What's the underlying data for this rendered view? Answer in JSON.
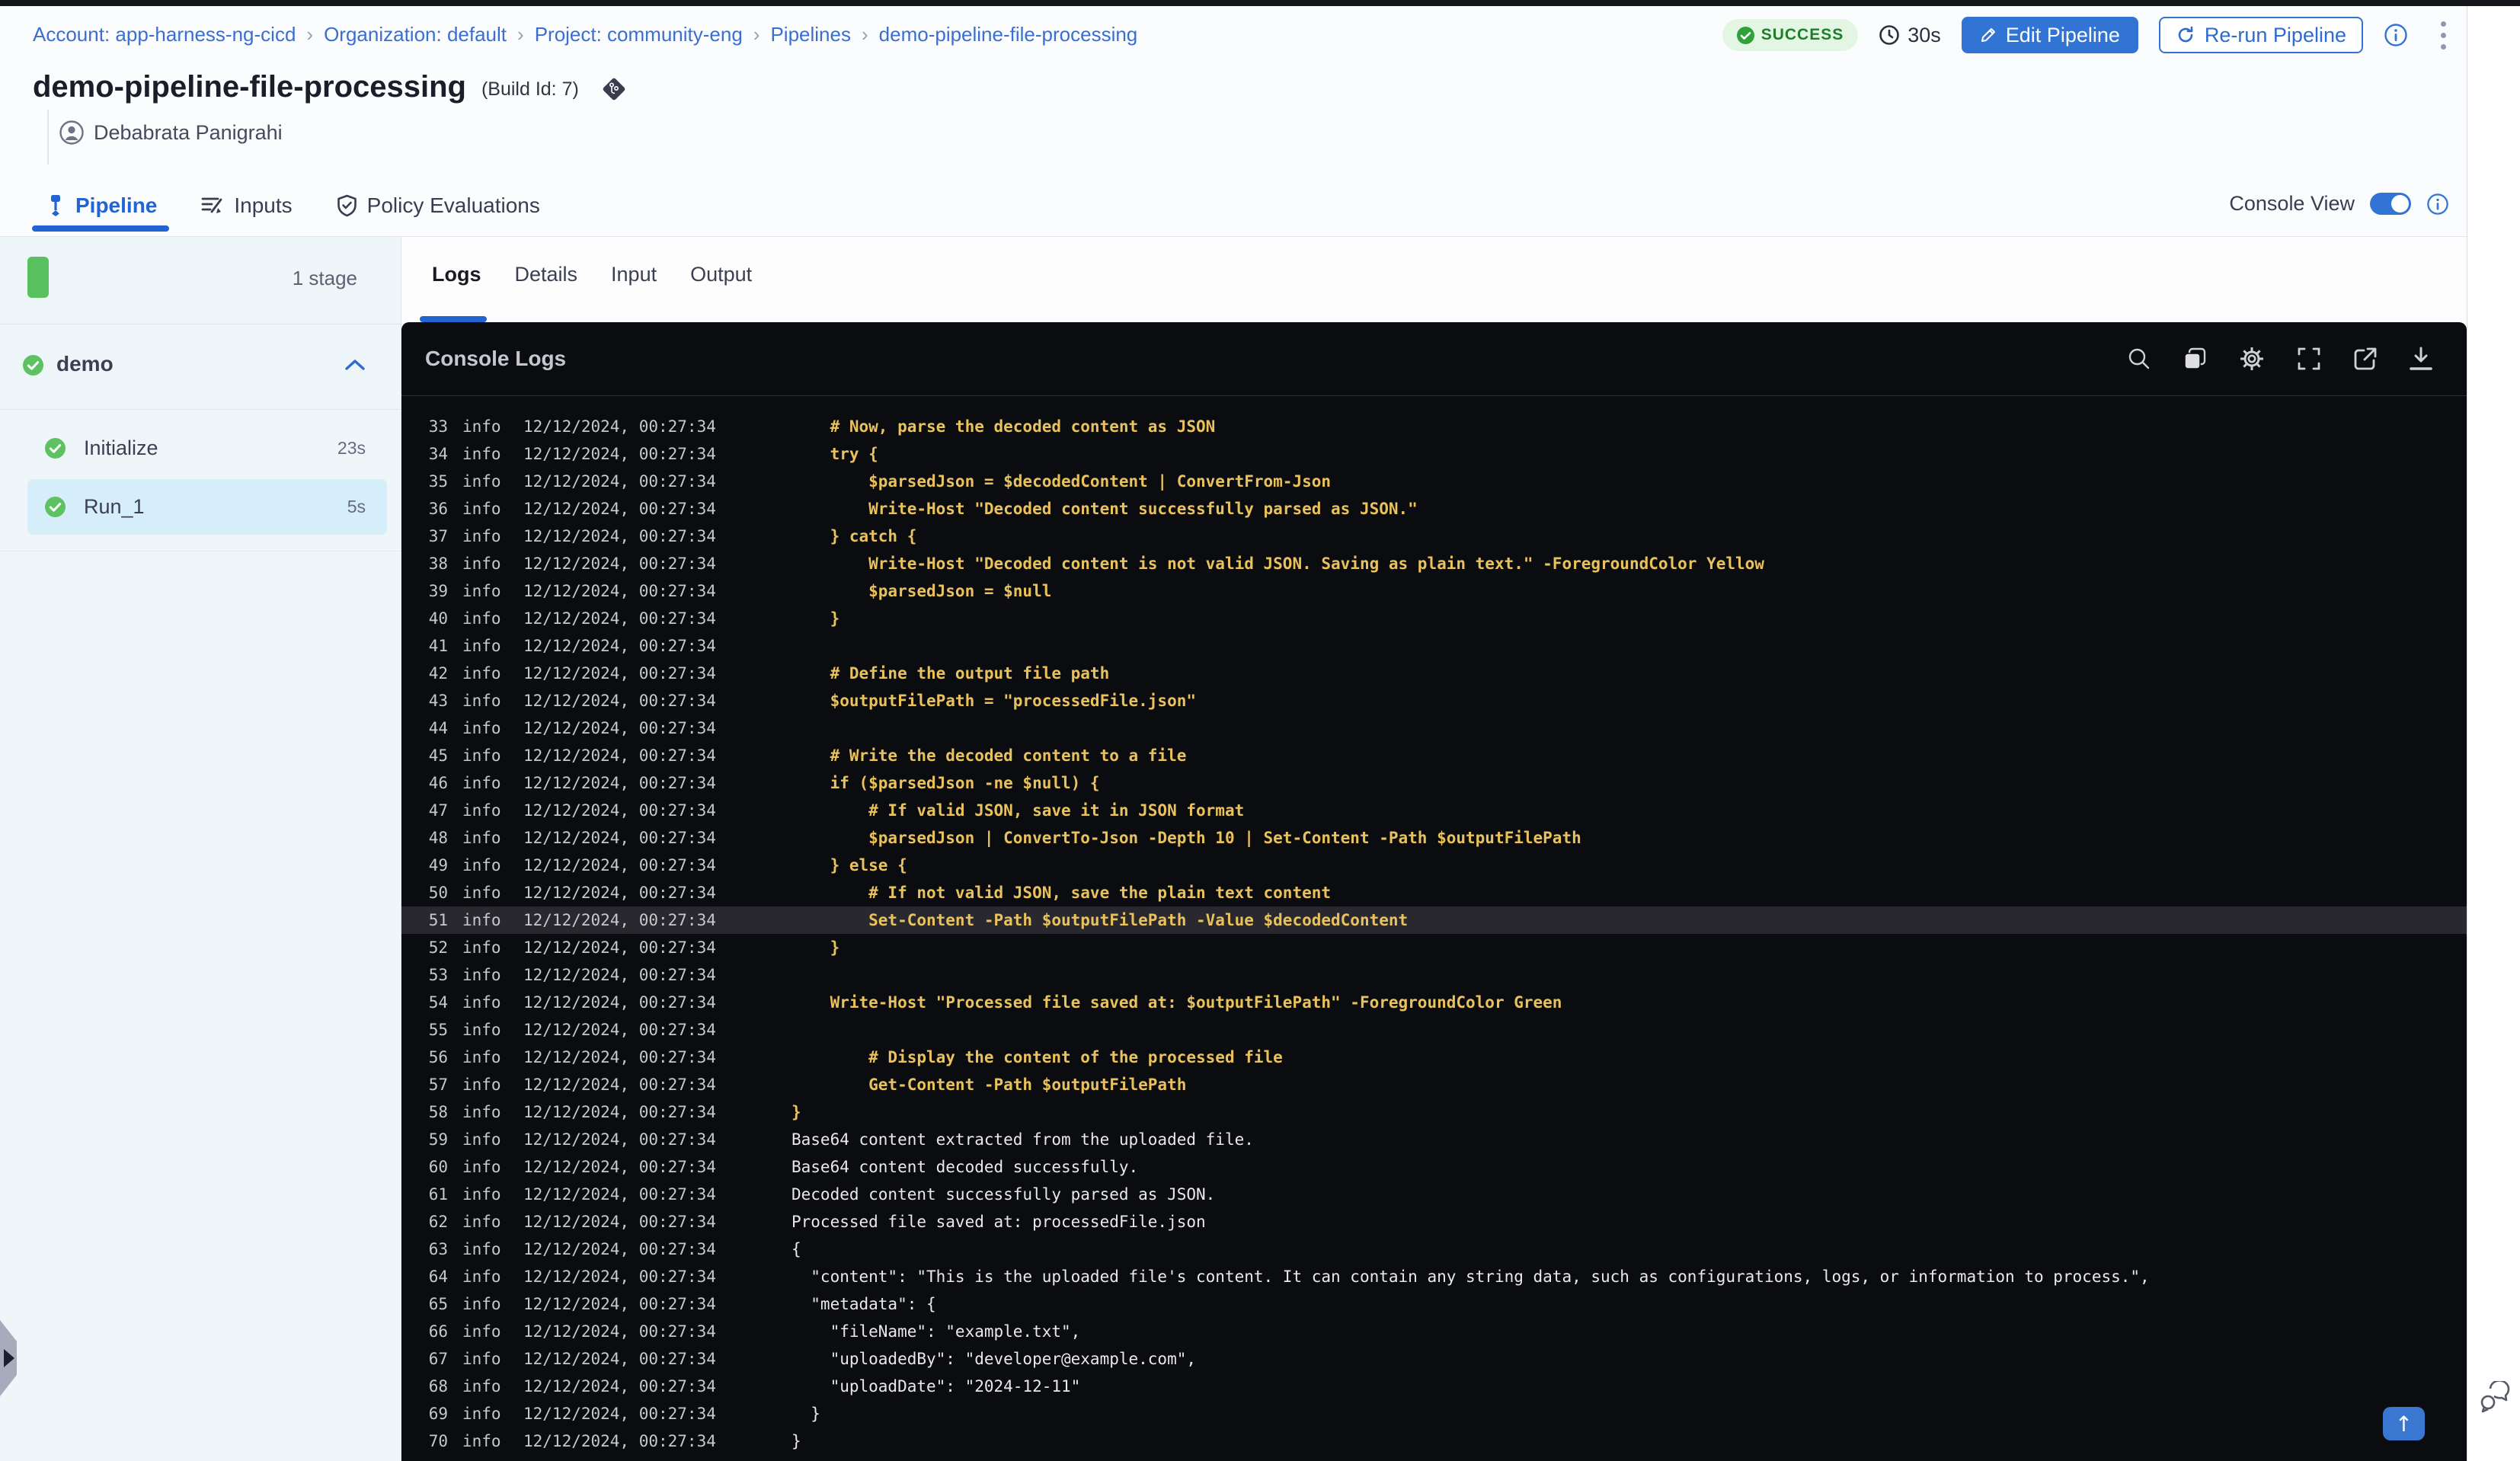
{
  "breadcrumb": {
    "separator": "›",
    "items": [
      {
        "label": "Account: app-harness-ng-cicd"
      },
      {
        "label": "Organization: default"
      },
      {
        "label": "Project: community-eng"
      },
      {
        "label": "Pipelines"
      },
      {
        "label": "demo-pipeline-file-processing"
      }
    ]
  },
  "header": {
    "title": "demo-pipeline-file-processing",
    "build_id": "(Build Id: 7)",
    "author": "Debabrata Panigrahi",
    "status_badge": "SUCCESS",
    "duration": "30s",
    "edit_button": "Edit Pipeline",
    "rerun_button": "Re-run Pipeline"
  },
  "tabs": {
    "pipeline": "Pipeline",
    "inputs": "Inputs",
    "policy": "Policy Evaluations",
    "console_view_label": "Console View",
    "console_view_on": true
  },
  "stage_panel": {
    "stage_count": "1 stage",
    "stage_name": "demo",
    "steps": [
      {
        "name": "Initialize",
        "duration": "23s"
      },
      {
        "name": "Run_1",
        "duration": "5s"
      }
    ]
  },
  "log_tabs": {
    "logs": "Logs",
    "details": "Details",
    "input": "Input",
    "output": "Output"
  },
  "console": {
    "title": "Console Logs",
    "toolbar_icons": [
      "search-icon",
      "copy-icon",
      "settings-icon",
      "fullscreen-icon",
      "open-in-new-icon",
      "download-icon"
    ],
    "scroll_top_icon": "arrow-up-icon",
    "scroll_top_glyph": "↑"
  },
  "colors": {
    "accent_blue": "#3174d4",
    "active_tab_blue": "#2264d1",
    "success_badge_bg": "#e3f6e3",
    "success_badge_text": "#1f7e2a",
    "check_green": "#5ec262",
    "log_yellow": "#e9c25d",
    "console_bg": "#0b0c0f",
    "selected_step_bg": "#d6edfa"
  },
  "logs": {
    "rows": [
      {
        "n": 33,
        "level": "info",
        "ts": "12/12/2024, 00:27:34",
        "tone": "yellow",
        "msg": "    # Now, parse the decoded content as JSON"
      },
      {
        "n": 34,
        "level": "info",
        "ts": "12/12/2024, 00:27:34",
        "tone": "yellow",
        "msg": "    try {"
      },
      {
        "n": 35,
        "level": "info",
        "ts": "12/12/2024, 00:27:34",
        "tone": "yellow",
        "msg": "        $parsedJson = $decodedContent | ConvertFrom-Json"
      },
      {
        "n": 36,
        "level": "info",
        "ts": "12/12/2024, 00:27:34",
        "tone": "yellow",
        "msg": "        Write-Host \"Decoded content successfully parsed as JSON.\""
      },
      {
        "n": 37,
        "level": "info",
        "ts": "12/12/2024, 00:27:34",
        "tone": "yellow",
        "msg": "    } catch {"
      },
      {
        "n": 38,
        "level": "info",
        "ts": "12/12/2024, 00:27:34",
        "tone": "yellow",
        "msg": "        Write-Host \"Decoded content is not valid JSON. Saving as plain text.\" -ForegroundColor Yellow"
      },
      {
        "n": 39,
        "level": "info",
        "ts": "12/12/2024, 00:27:34",
        "tone": "yellow",
        "msg": "        $parsedJson = $null"
      },
      {
        "n": 40,
        "level": "info",
        "ts": "12/12/2024, 00:27:34",
        "tone": "yellow",
        "msg": "    }"
      },
      {
        "n": 41,
        "level": "info",
        "ts": "12/12/2024, 00:27:34",
        "tone": "yellow",
        "msg": ""
      },
      {
        "n": 42,
        "level": "info",
        "ts": "12/12/2024, 00:27:34",
        "tone": "yellow",
        "msg": "    # Define the output file path"
      },
      {
        "n": 43,
        "level": "info",
        "ts": "12/12/2024, 00:27:34",
        "tone": "yellow",
        "msg": "    $outputFilePath = \"processedFile.json\""
      },
      {
        "n": 44,
        "level": "info",
        "ts": "12/12/2024, 00:27:34",
        "tone": "yellow",
        "msg": ""
      },
      {
        "n": 45,
        "level": "info",
        "ts": "12/12/2024, 00:27:34",
        "tone": "yellow",
        "msg": "    # Write the decoded content to a file"
      },
      {
        "n": 46,
        "level": "info",
        "ts": "12/12/2024, 00:27:34",
        "tone": "yellow",
        "msg": "    if ($parsedJson -ne $null) {"
      },
      {
        "n": 47,
        "level": "info",
        "ts": "12/12/2024, 00:27:34",
        "tone": "yellow",
        "msg": "        # If valid JSON, save it in JSON format"
      },
      {
        "n": 48,
        "level": "info",
        "ts": "12/12/2024, 00:27:34",
        "tone": "yellow",
        "msg": "        $parsedJson | ConvertTo-Json -Depth 10 | Set-Content -Path $outputFilePath"
      },
      {
        "n": 49,
        "level": "info",
        "ts": "12/12/2024, 00:27:34",
        "tone": "yellow",
        "msg": "    } else {"
      },
      {
        "n": 50,
        "level": "info",
        "ts": "12/12/2024, 00:27:34",
        "tone": "yellow",
        "msg": "        # If not valid JSON, save the plain text content"
      },
      {
        "n": 51,
        "level": "info",
        "ts": "12/12/2024, 00:27:34",
        "tone": "yellow",
        "highlight": true,
        "msg": "        Set-Content -Path $outputFilePath -Value $decodedContent"
      },
      {
        "n": 52,
        "level": "info",
        "ts": "12/12/2024, 00:27:34",
        "tone": "yellow",
        "msg": "    }"
      },
      {
        "n": 53,
        "level": "info",
        "ts": "12/12/2024, 00:27:34",
        "tone": "yellow",
        "msg": ""
      },
      {
        "n": 54,
        "level": "info",
        "ts": "12/12/2024, 00:27:34",
        "tone": "yellow",
        "msg": "    Write-Host \"Processed file saved at: $outputFilePath\" -ForegroundColor Green"
      },
      {
        "n": 55,
        "level": "info",
        "ts": "12/12/2024, 00:27:34",
        "tone": "yellow",
        "msg": ""
      },
      {
        "n": 56,
        "level": "info",
        "ts": "12/12/2024, 00:27:34",
        "tone": "yellow",
        "msg": "        # Display the content of the processed file"
      },
      {
        "n": 57,
        "level": "info",
        "ts": "12/12/2024, 00:27:34",
        "tone": "yellow",
        "msg": "        Get-Content -Path $outputFilePath"
      },
      {
        "n": 58,
        "level": "info",
        "ts": "12/12/2024, 00:27:34",
        "tone": "yellow",
        "msg": "}"
      },
      {
        "n": 59,
        "level": "info",
        "ts": "12/12/2024, 00:27:34",
        "tone": "white",
        "msg": "Base64 content extracted from the uploaded file."
      },
      {
        "n": 60,
        "level": "info",
        "ts": "12/12/2024, 00:27:34",
        "tone": "white",
        "msg": "Base64 content decoded successfully."
      },
      {
        "n": 61,
        "level": "info",
        "ts": "12/12/2024, 00:27:34",
        "tone": "white",
        "msg": "Decoded content successfully parsed as JSON."
      },
      {
        "n": 62,
        "level": "info",
        "ts": "12/12/2024, 00:27:34",
        "tone": "white",
        "msg": "Processed file saved at: processedFile.json"
      },
      {
        "n": 63,
        "level": "info",
        "ts": "12/12/2024, 00:27:34",
        "tone": "white",
        "msg": "{"
      },
      {
        "n": 64,
        "level": "info",
        "ts": "12/12/2024, 00:27:34",
        "tone": "white",
        "msg": "  \"content\": \"This is the uploaded file's content. It can contain any string data, such as configurations, logs, or information to process.\","
      },
      {
        "n": 65,
        "level": "info",
        "ts": "12/12/2024, 00:27:34",
        "tone": "white",
        "msg": "  \"metadata\": {"
      },
      {
        "n": 66,
        "level": "info",
        "ts": "12/12/2024, 00:27:34",
        "tone": "white",
        "msg": "    \"fileName\": \"example.txt\","
      },
      {
        "n": 67,
        "level": "info",
        "ts": "12/12/2024, 00:27:34",
        "tone": "white",
        "msg": "    \"uploadedBy\": \"developer@example.com\","
      },
      {
        "n": 68,
        "level": "info",
        "ts": "12/12/2024, 00:27:34",
        "tone": "white",
        "msg": "    \"uploadDate\": \"2024-12-11\""
      },
      {
        "n": 69,
        "level": "info",
        "ts": "12/12/2024, 00:27:34",
        "tone": "white",
        "msg": "  }"
      },
      {
        "n": 70,
        "level": "info",
        "ts": "12/12/2024, 00:27:34",
        "tone": "white",
        "msg": "}"
      }
    ]
  }
}
